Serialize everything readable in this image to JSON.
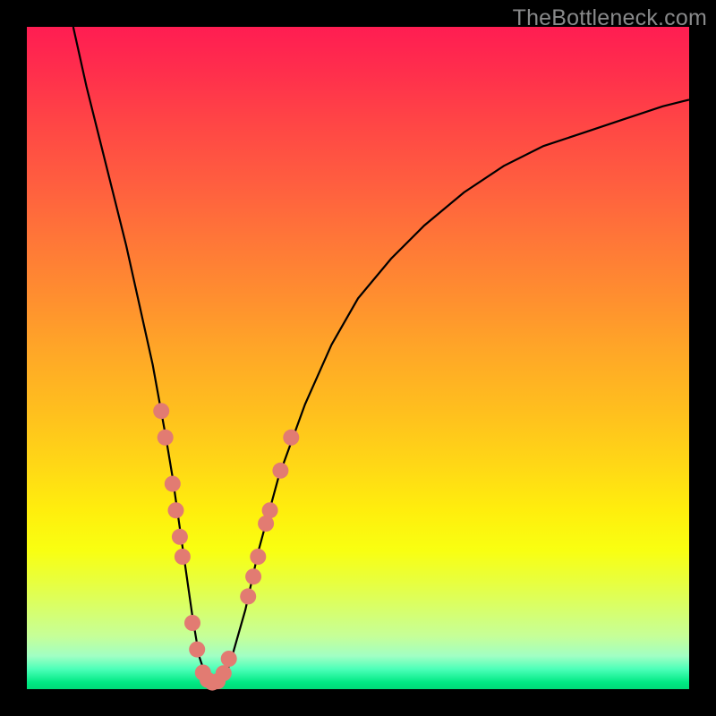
{
  "watermark": "TheBottleneck.com",
  "colors": {
    "frame": "#000000",
    "curve_stroke": "#000000",
    "marker_fill": "#e27b72",
    "marker_stroke": "#e27b72"
  },
  "chart_data": {
    "type": "line",
    "title": "",
    "xlabel": "",
    "ylabel": "",
    "xlim": [
      0,
      100
    ],
    "ylim": [
      0,
      100
    ],
    "series": [
      {
        "name": "bottleneck-curve",
        "x": [
          7,
          9,
          11,
          13,
          15,
          17,
          19,
          21,
          22,
          23,
          24,
          25,
          26,
          27,
          28,
          29,
          30,
          31,
          33,
          35,
          38,
          42,
          46,
          50,
          55,
          60,
          66,
          72,
          78,
          84,
          90,
          96,
          100
        ],
        "y": [
          100,
          91,
          83,
          75,
          67,
          58,
          49,
          38,
          32,
          25,
          18,
          11,
          5,
          2,
          1,
          1,
          2,
          5,
          12,
          21,
          32,
          43,
          52,
          59,
          65,
          70,
          75,
          79,
          82,
          84,
          86,
          88,
          89
        ]
      }
    ],
    "markers": {
      "name": "highlight-points",
      "points": [
        {
          "x": 20.3,
          "y": 42
        },
        {
          "x": 20.9,
          "y": 38
        },
        {
          "x": 22.0,
          "y": 31
        },
        {
          "x": 22.5,
          "y": 27
        },
        {
          "x": 23.1,
          "y": 23
        },
        {
          "x": 23.5,
          "y": 20
        },
        {
          "x": 25.0,
          "y": 10
        },
        {
          "x": 25.7,
          "y": 6
        },
        {
          "x": 26.6,
          "y": 2.5
        },
        {
          "x": 27.3,
          "y": 1.4
        },
        {
          "x": 28.0,
          "y": 1.0
        },
        {
          "x": 28.8,
          "y": 1.2
        },
        {
          "x": 29.7,
          "y": 2.4
        },
        {
          "x": 30.5,
          "y": 4.6
        },
        {
          "x": 33.4,
          "y": 14
        },
        {
          "x": 34.2,
          "y": 17
        },
        {
          "x": 34.9,
          "y": 20
        },
        {
          "x": 36.1,
          "y": 25
        },
        {
          "x": 36.7,
          "y": 27
        },
        {
          "x": 38.3,
          "y": 33
        },
        {
          "x": 39.9,
          "y": 38
        }
      ]
    }
  }
}
